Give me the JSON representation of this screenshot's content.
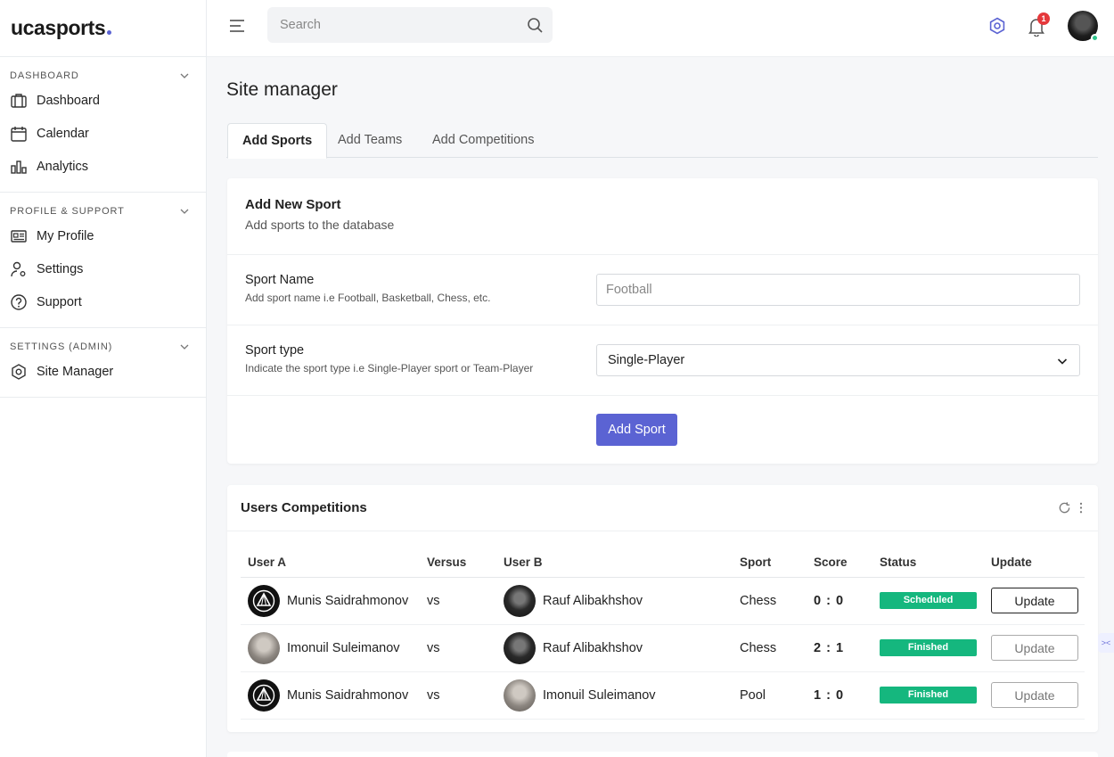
{
  "brand": {
    "name": "ucasports",
    "accent": "#5b63d3"
  },
  "sidebar": {
    "sections": [
      {
        "title": "DASHBOARD",
        "items": [
          {
            "label": "Dashboard",
            "icon": "briefcase-icon"
          },
          {
            "label": "Calendar",
            "icon": "calendar-icon"
          },
          {
            "label": "Analytics",
            "icon": "bar-chart-icon"
          }
        ]
      },
      {
        "title": "PROFILE & SUPPORT",
        "items": [
          {
            "label": "My Profile",
            "icon": "id-card-icon"
          },
          {
            "label": "Settings",
            "icon": "user-gear-icon"
          },
          {
            "label": "Support",
            "icon": "help-circle-icon"
          }
        ]
      },
      {
        "title": "SETTINGS (ADMIN)",
        "items": [
          {
            "label": "Site Manager",
            "icon": "hexagon-settings-icon"
          }
        ]
      }
    ]
  },
  "topbar": {
    "search_placeholder": "Search",
    "notification_count": "1"
  },
  "page": {
    "title": "Site manager"
  },
  "tabs": [
    {
      "label": "Add Sports",
      "active": true
    },
    {
      "label": "Add Teams",
      "active": false
    },
    {
      "label": "Add Competitions",
      "active": false
    }
  ],
  "add_sport": {
    "title": "Add New Sport",
    "subtitle": "Add sports to the database",
    "name_label": "Sport Name",
    "name_hint": "Add sport name i.e Football, Basketball, Chess, etc.",
    "name_placeholder": "Football",
    "type_label": "Sport type",
    "type_hint": "Indicate the sport type i.e Single-Player sport or Team-Player",
    "type_value": "Single-Player",
    "button": "Add Sport"
  },
  "competitions": {
    "title": "Users Competitions",
    "columns": [
      "User A",
      "Versus",
      "User B",
      "Sport",
      "Score",
      "Status",
      "Update"
    ],
    "rows": [
      {
        "user_a": "Munis Saidrahmonov",
        "user_a_avatar": "logo",
        "versus": "vs",
        "user_b": "Rauf Alibakhshov",
        "user_b_avatar": "dark",
        "sport": "Chess",
        "score": "0 : 0",
        "status": "Scheduled",
        "update": "Update",
        "update_enabled": true
      },
      {
        "user_a": "Imonuil Suleimanov",
        "user_a_avatar": "light",
        "versus": "vs",
        "user_b": "Rauf Alibakhshov",
        "user_b_avatar": "dark",
        "sport": "Chess",
        "score": "2 : 1",
        "status": "Finished",
        "update": "Update",
        "update_enabled": false
      },
      {
        "user_a": "Munis Saidrahmonov",
        "user_a_avatar": "logo",
        "versus": "vs",
        "user_b": "Imonuil Suleimanov",
        "user_b_avatar": "light",
        "sport": "Pool",
        "score": "1 : 0",
        "status": "Finished",
        "update": "Update",
        "update_enabled": false
      }
    ],
    "status_color": "#15b77e"
  }
}
